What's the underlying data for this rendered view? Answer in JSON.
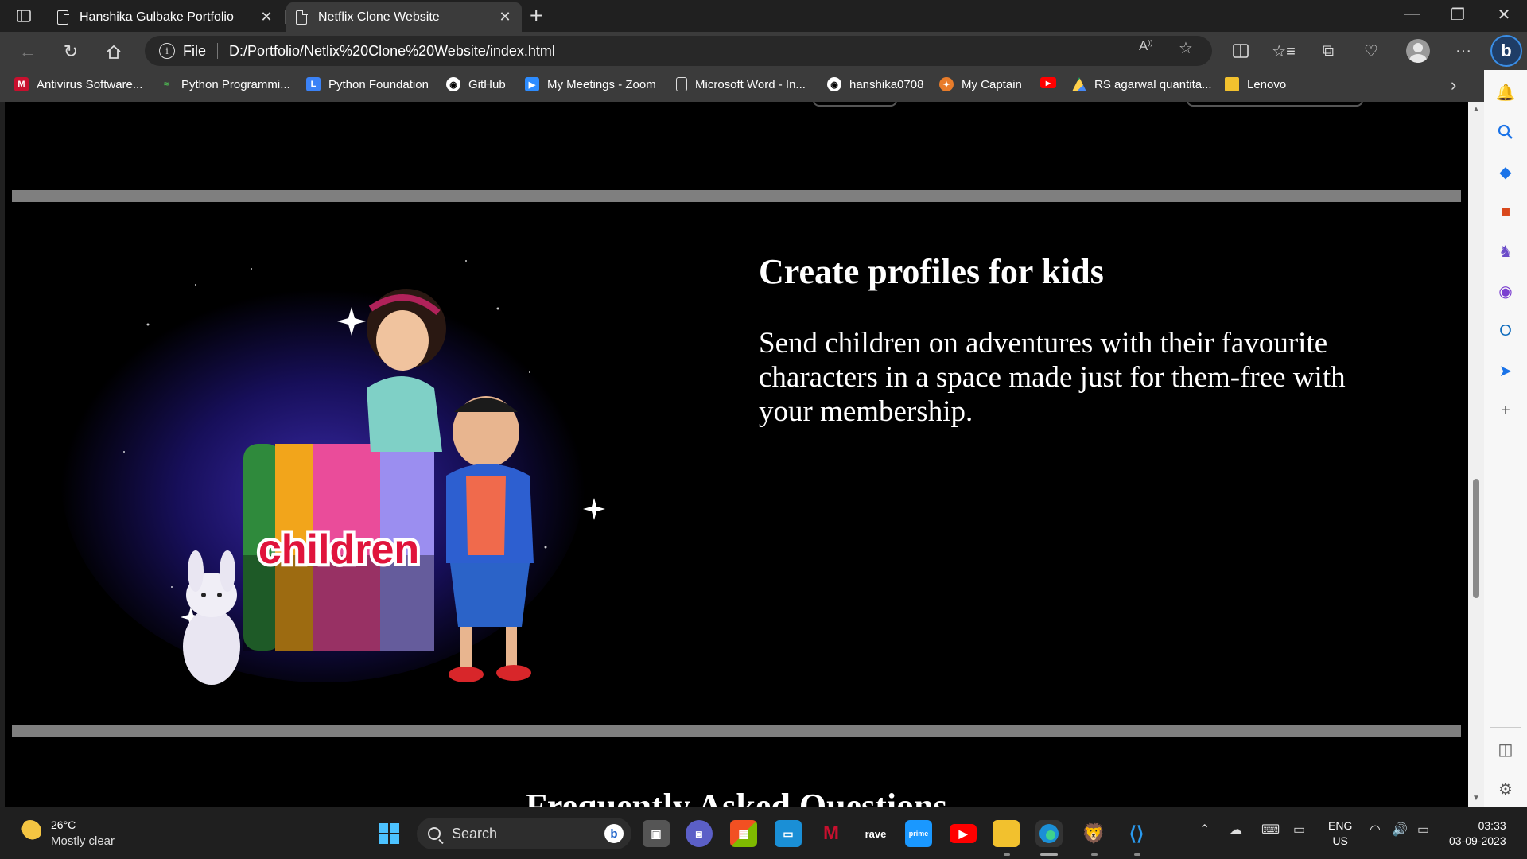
{
  "browser": {
    "tabs": [
      {
        "title": "Hanshika Gulbake Portfolio",
        "active": false
      },
      {
        "title": "Netflix Clone Website",
        "active": true
      }
    ],
    "address": {
      "scheme_label": "File",
      "url": "D:/Portfolio/Netlix%20Clone%20Website/index.html"
    },
    "bookmarks": [
      {
        "label": "Antivirus Software...",
        "icon": "mcafee-icon",
        "color": "#c8102e"
      },
      {
        "label": "Python Programmi...",
        "icon": "python-programming-icon",
        "color": "#4caf50"
      },
      {
        "label": "Python Foundation",
        "icon": "python-foundation-icon",
        "color": "#3b82f6"
      },
      {
        "label": "GitHub",
        "icon": "github-icon",
        "color": "#ffffff"
      },
      {
        "label": "My Meetings - Zoom",
        "icon": "zoom-icon",
        "color": "#2d8cff"
      },
      {
        "label": "Microsoft Word - In...",
        "icon": "document-icon",
        "color": "#dddddd"
      },
      {
        "label": "hanshika0708",
        "icon": "github-icon",
        "color": "#ffffff"
      },
      {
        "label": "My Captain",
        "icon": "mycaptain-icon",
        "color": "#e87c2a"
      },
      {
        "label": "",
        "icon": "youtube-icon",
        "color": "#ff0000"
      },
      {
        "label": "RS agarwal quantita...",
        "icon": "google-drive-icon",
        "color": "#1fa463"
      },
      {
        "label": "Lenovo",
        "icon": "folder-icon",
        "color": "#f2c12e"
      }
    ]
  },
  "page": {
    "feature_title": "Create profiles for kids",
    "feature_desc": "Send children on adventures with their favourite characters in a space made just for them-free with your membership.",
    "faq_heading": "Frequently Asked Questions",
    "kids_image_text": "children"
  },
  "taskbar": {
    "weather_temp": "26°C",
    "weather_desc": "Mostly clear",
    "search_placeholder": "Search",
    "lang_primary": "ENG",
    "lang_secondary": "US",
    "time": "03:33",
    "date": "03-09-2023"
  }
}
